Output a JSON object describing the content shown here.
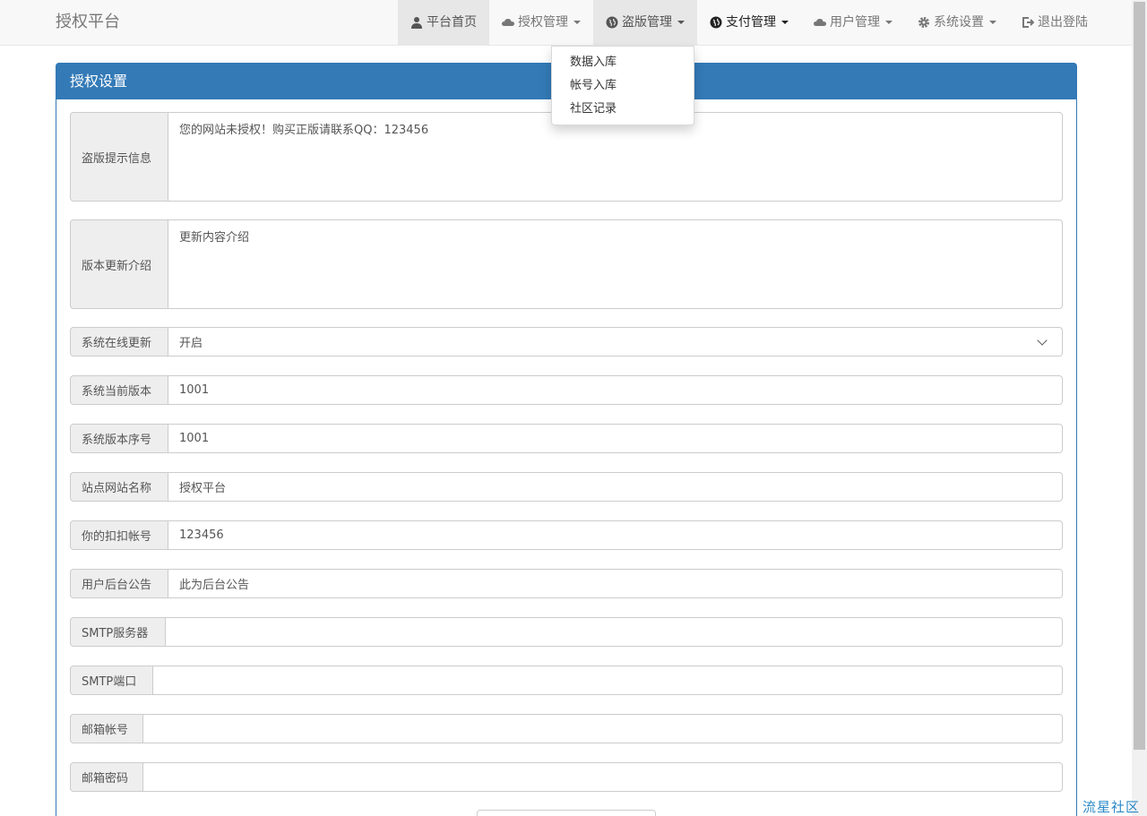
{
  "brand": "授权平台",
  "nav": [
    {
      "label": "平台首页",
      "icon": "user-icon"
    },
    {
      "label": "授权管理",
      "icon": "cloud-icon"
    },
    {
      "label": "盗版管理",
      "icon": "globe-icon"
    },
    {
      "label": "支付管理",
      "icon": "globe-icon"
    },
    {
      "label": "用户管理",
      "icon": "cloud-icon"
    },
    {
      "label": "系统设置",
      "icon": "gear-icon"
    },
    {
      "label": "退出登陆",
      "icon": "logout-icon"
    }
  ],
  "dropdown": [
    "数据入库",
    "帐号入库",
    "社区记录"
  ],
  "panel": {
    "title": "授权设置"
  },
  "form": [
    {
      "label": "盗版提示信息",
      "value": "您的网站未授权！购买正版请联系QQ：123456",
      "type": "textarea"
    },
    {
      "label": "版本更新介绍",
      "value": "更新内容介绍",
      "type": "textarea"
    },
    {
      "label": "系统在线更新",
      "value": "开启",
      "type": "select"
    },
    {
      "label": "系统当前版本",
      "value": "1001",
      "type": "input"
    },
    {
      "label": "系统版本序号",
      "value": "1001",
      "type": "input"
    },
    {
      "label": "站点网站名称",
      "value": "授权平台",
      "type": "input"
    },
    {
      "label": "你的扣扣帐号",
      "value": "123456",
      "type": "input"
    },
    {
      "label": "用户后台公告",
      "value": "此为后台公告",
      "type": "input"
    },
    {
      "label": "SMTP服务器",
      "value": "",
      "type": "input"
    },
    {
      "label": "SMTP端口",
      "value": "",
      "type": "input"
    },
    {
      "label": "邮箱帐号",
      "value": "",
      "type": "input"
    },
    {
      "label": "邮箱密码",
      "value": "",
      "type": "input"
    }
  ],
  "watermark": "流星社区",
  "colors": {
    "primary": "#337ab7",
    "navbar": "#f8f8f8",
    "addon": "#eeeeee"
  }
}
